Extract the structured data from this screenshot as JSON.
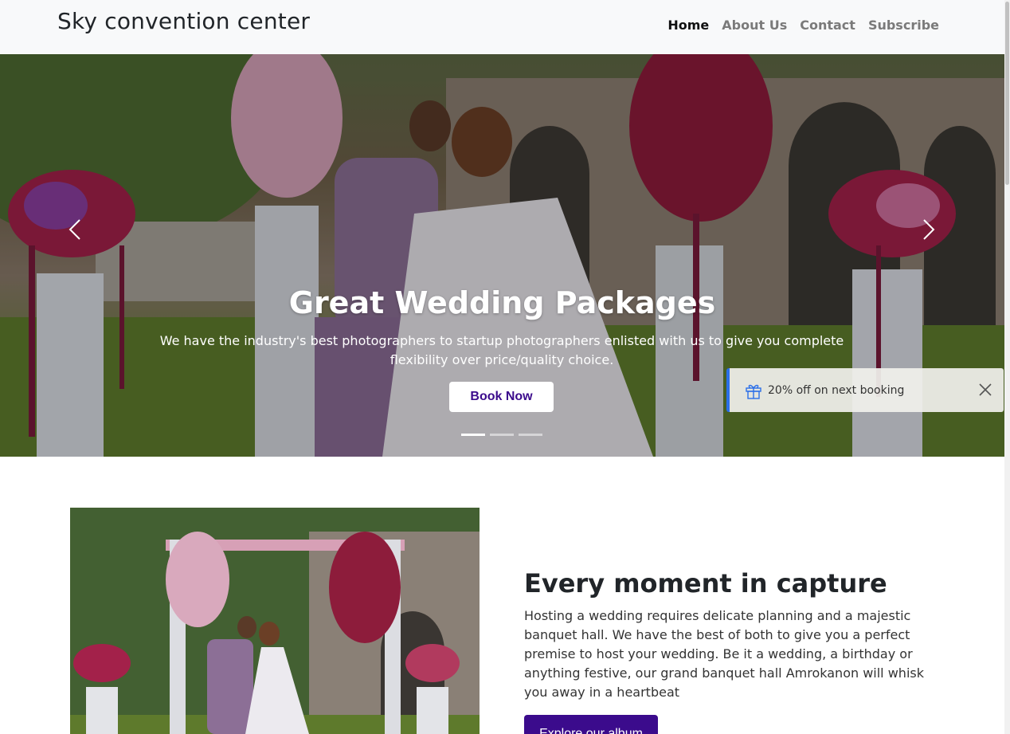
{
  "navbar": {
    "brand": "Sky convention center",
    "links": [
      {
        "label": "Home",
        "active": true
      },
      {
        "label": "About Us",
        "active": false
      },
      {
        "label": "Contact",
        "active": false
      },
      {
        "label": "Subscribe",
        "active": false
      }
    ]
  },
  "hero": {
    "title": "Great Wedding Packages",
    "subtitle": "We have the industry's best photographers to startup photographers enlisted with us to give you complete flexibility over price/quality choice.",
    "button_label": "Book Now",
    "slides_count": 3,
    "active_slide": 1,
    "prev_icon": "chevron-left-icon",
    "next_icon": "chevron-right-icon"
  },
  "toast": {
    "icon": "gift-icon",
    "message": "20% off on next booking",
    "close_icon": "close-icon",
    "accent_color": "#2b6fe8"
  },
  "feature": {
    "title": "Every moment in capture",
    "text": "Hosting a wedding requires delicate planning and a majestic banquet hall. We have the best of both to give you a perfect premise to host your wedding. Be it a wedding, a birthday or anything festive, our grand banquet hall Amrokanon will whisk you away in a heartbeat",
    "button_label": "Explore our album"
  },
  "colors": {
    "brand_purple": "#3b0b8c",
    "navbar_bg": "#f8f9fa"
  }
}
